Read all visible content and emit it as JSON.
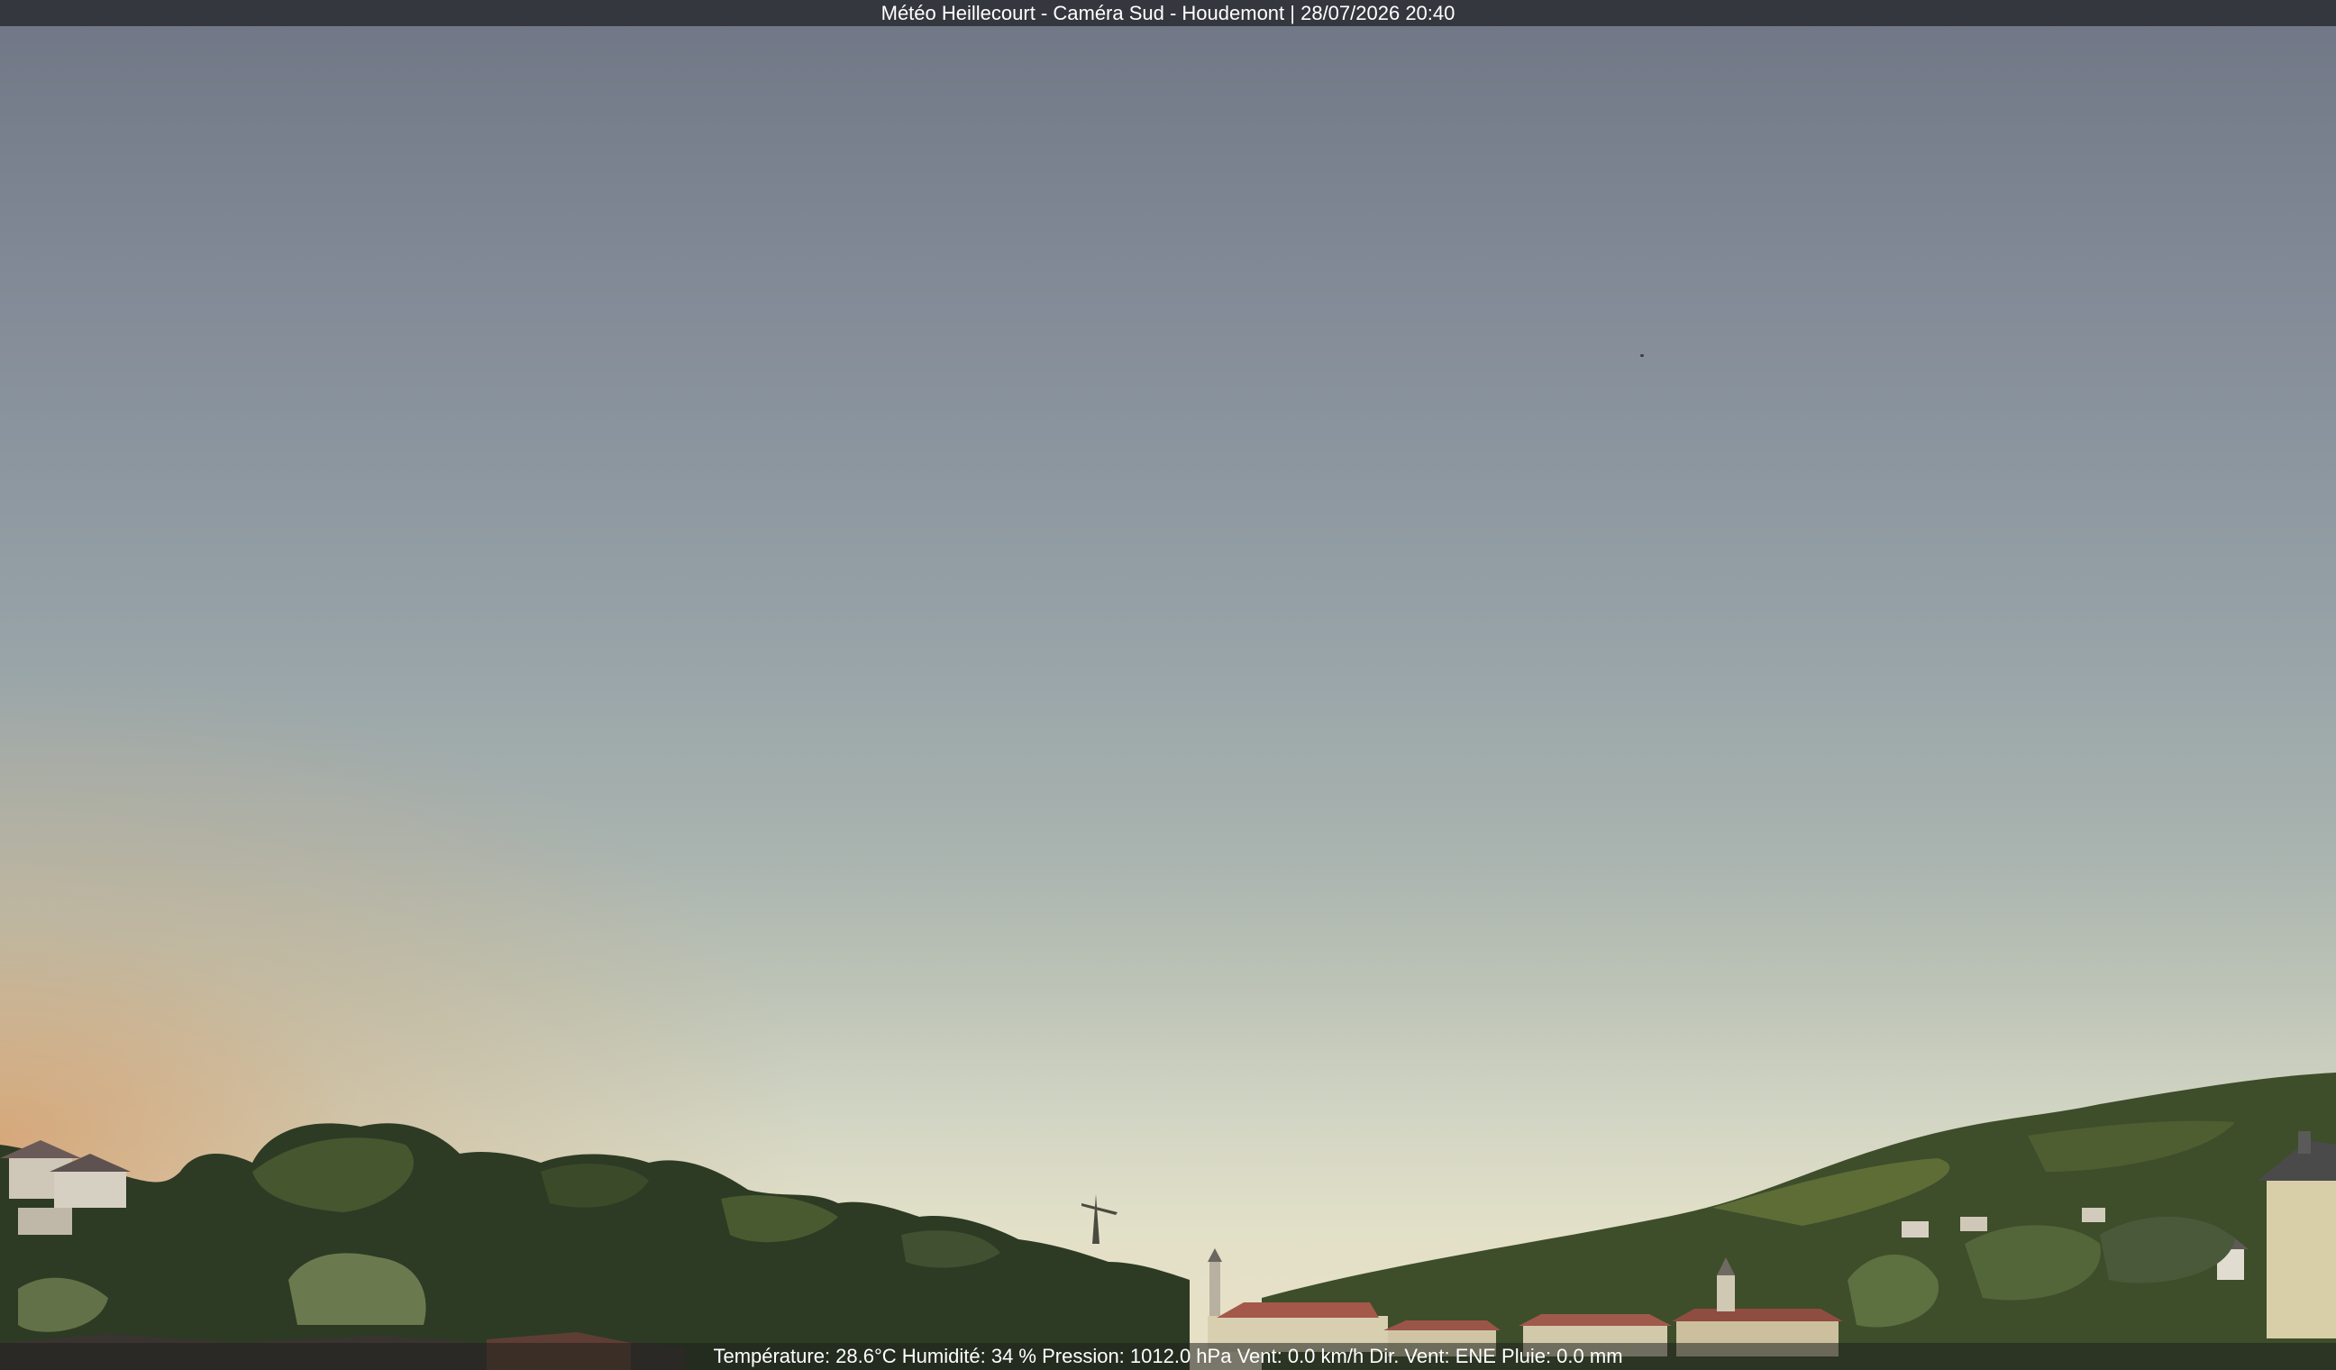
{
  "camera": {
    "title": "Météo Heillecourt - Caméra Sud - Houdemont | 28/07/2026 20:40"
  },
  "weather": {
    "readout": "Température: 28.6°C  Humidité: 34 % Pression: 1012.0 hPa Vent: 0.0 km/h Dir. Vent: ENE Pluie: 0.0 mm"
  },
  "colors": {
    "sky_top": "#6f7584",
    "sky_horizon": "#e8e0c6",
    "sunset_glow": "#d6a06e",
    "trees_dark": "#2c3a22",
    "trees_light": "#5b6e3a",
    "hill_right": "#3f4f2a",
    "roof_red": "#a4584a",
    "house_wall": "#d8cfa8"
  }
}
